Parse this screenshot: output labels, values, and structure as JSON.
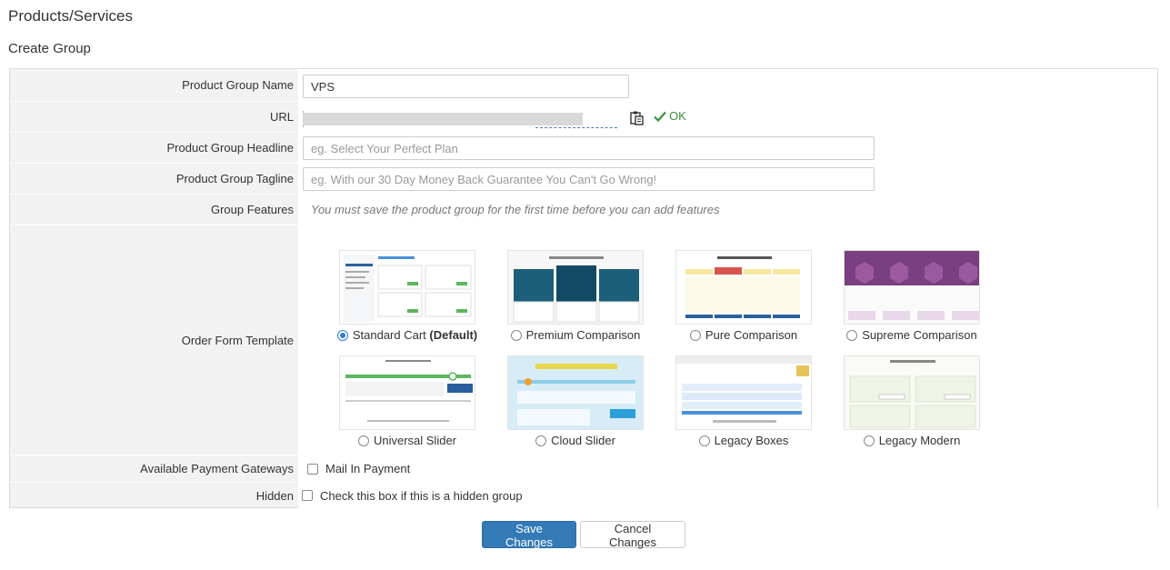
{
  "header": {
    "page_title": "Products/Services",
    "section_title": "Create Group"
  },
  "form": {
    "group_name": {
      "label": "Product Group Name",
      "value": "VPS"
    },
    "url": {
      "label": "URL",
      "status": "OK",
      "status_icon": "check-icon",
      "copy_icon": "clipboard-icon"
    },
    "headline": {
      "label": "Product Group Headline",
      "placeholder": "eg. Select Your Perfect Plan"
    },
    "tagline": {
      "label": "Product Group Tagline",
      "placeholder": "eg. With our 30 Day Money Back Guarantee You Can't Go Wrong!"
    },
    "features": {
      "label": "Group Features",
      "note": "You must save the product group for the first time before you can add features"
    },
    "order_form_template": {
      "label": "Order Form Template",
      "selected": "Standard Cart",
      "templates": [
        {
          "name": "Standard Cart",
          "suffix": "(Default)"
        },
        {
          "name": "Premium Comparison",
          "suffix": ""
        },
        {
          "name": "Pure Comparison",
          "suffix": ""
        },
        {
          "name": "Supreme Comparison",
          "suffix": ""
        },
        {
          "name": "Universal Slider",
          "suffix": ""
        },
        {
          "name": "Cloud Slider",
          "suffix": ""
        },
        {
          "name": "Legacy Boxes",
          "suffix": ""
        },
        {
          "name": "Legacy Modern",
          "suffix": ""
        }
      ]
    },
    "payment_gateways": {
      "label": "Available Payment Gateways",
      "option": "Mail In Payment",
      "checked": false
    },
    "hidden": {
      "label": "Hidden",
      "option": "Check this box if this is a hidden group",
      "checked": false
    }
  },
  "actions": {
    "save_label": "Save Changes",
    "cancel_label": "Cancel Changes"
  },
  "colors": {
    "primary": "#337ab7",
    "ok_green": "#3c8f3c",
    "row_bg": "#f2f2f2"
  }
}
